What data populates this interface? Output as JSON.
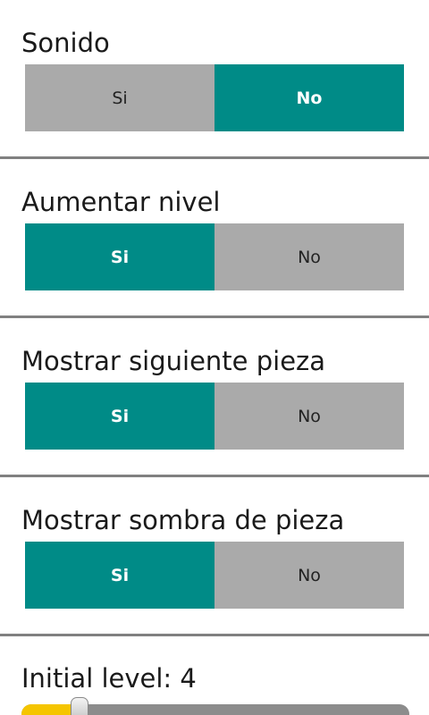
{
  "settings": [
    {
      "title": "Sonido",
      "yes": "Si",
      "no": "No",
      "selected": "no"
    },
    {
      "title": "Aumentar nivel",
      "yes": "Si",
      "no": "No",
      "selected": "yes"
    },
    {
      "title": "Mostrar siguiente pieza",
      "yes": "Si",
      "no": "No",
      "selected": "yes"
    },
    {
      "title": "Mostrar sombra de pieza",
      "yes": "Si",
      "no": "No",
      "selected": "yes"
    }
  ],
  "level": {
    "label": "Initial level: 4",
    "value": 4,
    "fraction": 0.15
  },
  "colors": {
    "selected": "#008b87",
    "unselected": "#aaaaaa",
    "divider": "#808080",
    "slider_fill": "#f5c500",
    "slider_track": "#8c8c8c"
  }
}
